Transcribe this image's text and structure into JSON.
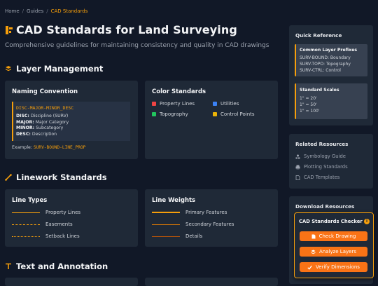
{
  "breadcrumb": {
    "items": [
      "Home",
      "Guides"
    ],
    "current": "CAD Standards",
    "separator": "/"
  },
  "page": {
    "title": "CAD Standards for Land Surveying",
    "subtitle": "Comprehensive guidelines for maintaining consistency and quality in CAD drawings"
  },
  "sections": {
    "layer_management": "Layer Management",
    "linework": "Linework Standards",
    "text": "Text and Annotation"
  },
  "naming": {
    "title": "Naming Convention",
    "pattern": "DISC-MAJOR-MINOR_DESC",
    "rows": [
      {
        "key": "DISC:",
        "value": "Discipline (SURV)"
      },
      {
        "key": "MAJOR:",
        "value": "Major Category"
      },
      {
        "key": "MINOR:",
        "value": "Subcategory"
      },
      {
        "key": "DESC:",
        "value": "Description"
      }
    ],
    "example_label": "Example:",
    "example_value": "SURV-BOUND-LINE_PROP"
  },
  "colors": {
    "title": "Color Standards",
    "items": [
      {
        "label": "Property Lines",
        "color": "#ef4444"
      },
      {
        "label": "Utilities",
        "color": "#3b82f6"
      },
      {
        "label": "Topography",
        "color": "#22c55e"
      },
      {
        "label": "Control Points",
        "color": "#eab308"
      }
    ]
  },
  "line_types": {
    "title": "Line Types",
    "items": [
      {
        "label": "Property Lines",
        "style": "solid"
      },
      {
        "label": "Easements",
        "style": "dashed"
      },
      {
        "label": "Setback Lines",
        "style": "dotted"
      }
    ]
  },
  "line_weights": {
    "title": "Line Weights",
    "items": [
      {
        "label": "Primary Features",
        "weight": "heavy"
      },
      {
        "label": "Secondary Features",
        "weight": "medium"
      },
      {
        "label": "Details",
        "weight": "light"
      }
    ]
  },
  "sidebar": {
    "quick_ref": {
      "title": "Quick Reference",
      "prefixes_title": "Common Layer Prefixes",
      "prefixes": [
        "SURV-BOUND: Boundary",
        "SURV-TOPO: Topography",
        "SURV-CTRL: Control"
      ],
      "scales_title": "Standard Scales",
      "scales": [
        "1\" = 20'",
        "1\" = 50'",
        "1\" = 100'"
      ]
    },
    "related": {
      "title": "Related Resources",
      "items": [
        {
          "label": "Symbology Guide",
          "icon": "symbols-icon"
        },
        {
          "label": "Plotting Standards",
          "icon": "printer-icon"
        },
        {
          "label": "CAD Templates",
          "icon": "file-icon"
        }
      ]
    },
    "downloads": {
      "title": "Download Resources"
    },
    "checker": {
      "title": "CAD Standards Checker",
      "buttons": [
        "Check Drawing",
        "Analyze Layers",
        "Verify Dimensions"
      ]
    }
  },
  "accent": "#f59e0b",
  "button_color": "#f97316"
}
